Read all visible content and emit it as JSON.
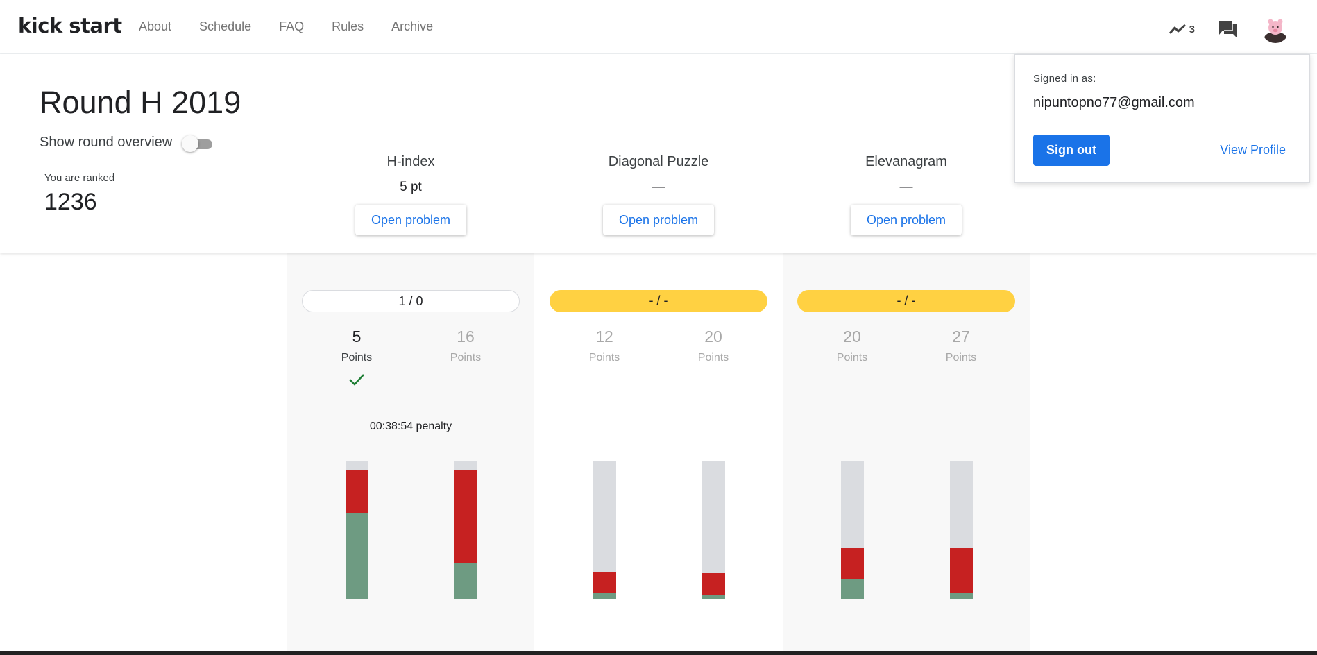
{
  "header": {
    "logo": "kick start",
    "nav": [
      "About",
      "Schedule",
      "FAQ",
      "Rules",
      "Archive"
    ],
    "trend_count": "3"
  },
  "round": {
    "title": "Round H 2019",
    "overview_label": "Show round overview",
    "ranked_label": "You are ranked",
    "rank": "1236"
  },
  "problems": [
    {
      "name": "H-index",
      "score": "5 pt",
      "button": "Open problem",
      "status": "1 / 0",
      "status_color": "white",
      "subtasks": [
        {
          "points": "5",
          "label": "Points",
          "state": "solved",
          "bar": {
            "red": 0.31,
            "green": 0.62
          }
        },
        {
          "points": "16",
          "label": "Points",
          "state": "unsolved",
          "bar": {
            "red": 0.67,
            "green": 0.26
          }
        }
      ],
      "penalty": "00:38:54 penalty"
    },
    {
      "name": "Diagonal Puzzle",
      "score": "—",
      "button": "Open problem",
      "status": "- / -",
      "status_color": "yellow",
      "subtasks": [
        {
          "points": "12",
          "label": "Points",
          "state": "unsolved",
          "bar": {
            "red": 0.15,
            "green": 0.05
          }
        },
        {
          "points": "20",
          "label": "Points",
          "state": "unsolved",
          "bar": {
            "red": 0.16,
            "green": 0.03
          }
        }
      ],
      "penalty": ""
    },
    {
      "name": "Elevanagram",
      "score": "—",
      "button": "Open problem",
      "status": "- / -",
      "status_color": "yellow",
      "subtasks": [
        {
          "points": "20",
          "label": "Points",
          "state": "unsolved",
          "bar": {
            "red": 0.22,
            "green": 0.15
          }
        },
        {
          "points": "27",
          "label": "Points",
          "state": "unsolved",
          "bar": {
            "red": 0.32,
            "green": 0.05
          }
        }
      ],
      "penalty": ""
    }
  ],
  "profile": {
    "signed_in_label": "Signed in as:",
    "email": "nipuntopno77@gmail.com",
    "sign_out": "Sign out",
    "view_profile": "View Profile"
  },
  "colors": {
    "accent": "#1a73e8",
    "pending": "#ffd142",
    "incorrect": "#c62121",
    "correct": "#6e9b82",
    "check": "#1e7e34"
  }
}
